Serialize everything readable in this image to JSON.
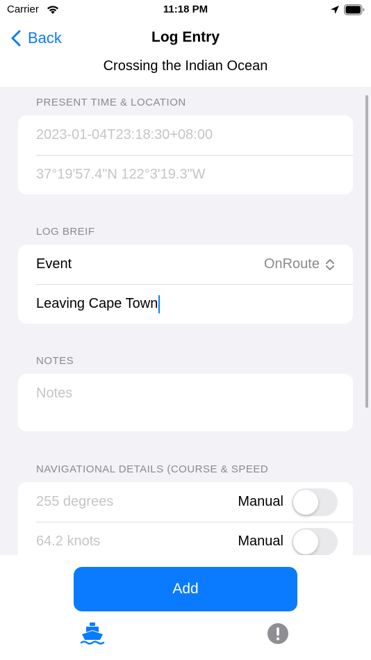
{
  "status_bar": {
    "carrier": "Carrier",
    "time": "11:18 PM"
  },
  "nav": {
    "back_label": "Back",
    "title": "Log Entry"
  },
  "voyage_title": "Crossing the Indian Ocean",
  "sections": {
    "time_location": {
      "header": "PRESENT TIME & LOCATION",
      "timestamp_placeholder": "2023-01-04T23:18:30+08:00",
      "location_placeholder": "37°19'57.4\"N 122°3'19.3\"W"
    },
    "log_brief": {
      "header": "LOG BREIF",
      "event_label": "Event",
      "event_value": "OnRoute",
      "brief_text": "Leaving Cape Town"
    },
    "notes": {
      "header": "NOTES",
      "placeholder": "Notes"
    },
    "navigation": {
      "header": "NAVIGATIONAL DETAILS (COURSE & SPEED",
      "course_placeholder": "255 degrees",
      "course_toggle_label": "Manual",
      "course_manual": false,
      "speed_placeholder": "64.2 knots",
      "speed_toggle_label": "Manual",
      "speed_manual": false
    }
  },
  "add_button": "Add",
  "tabs": [
    {
      "icon": "ship-icon",
      "selected": true
    },
    {
      "icon": "alert-icon",
      "selected": false
    }
  ],
  "colors": {
    "accent": "#0a7aff",
    "background": "#f2f2f7",
    "placeholder": "#c5c5c7",
    "secondary": "#8a8a8e"
  }
}
